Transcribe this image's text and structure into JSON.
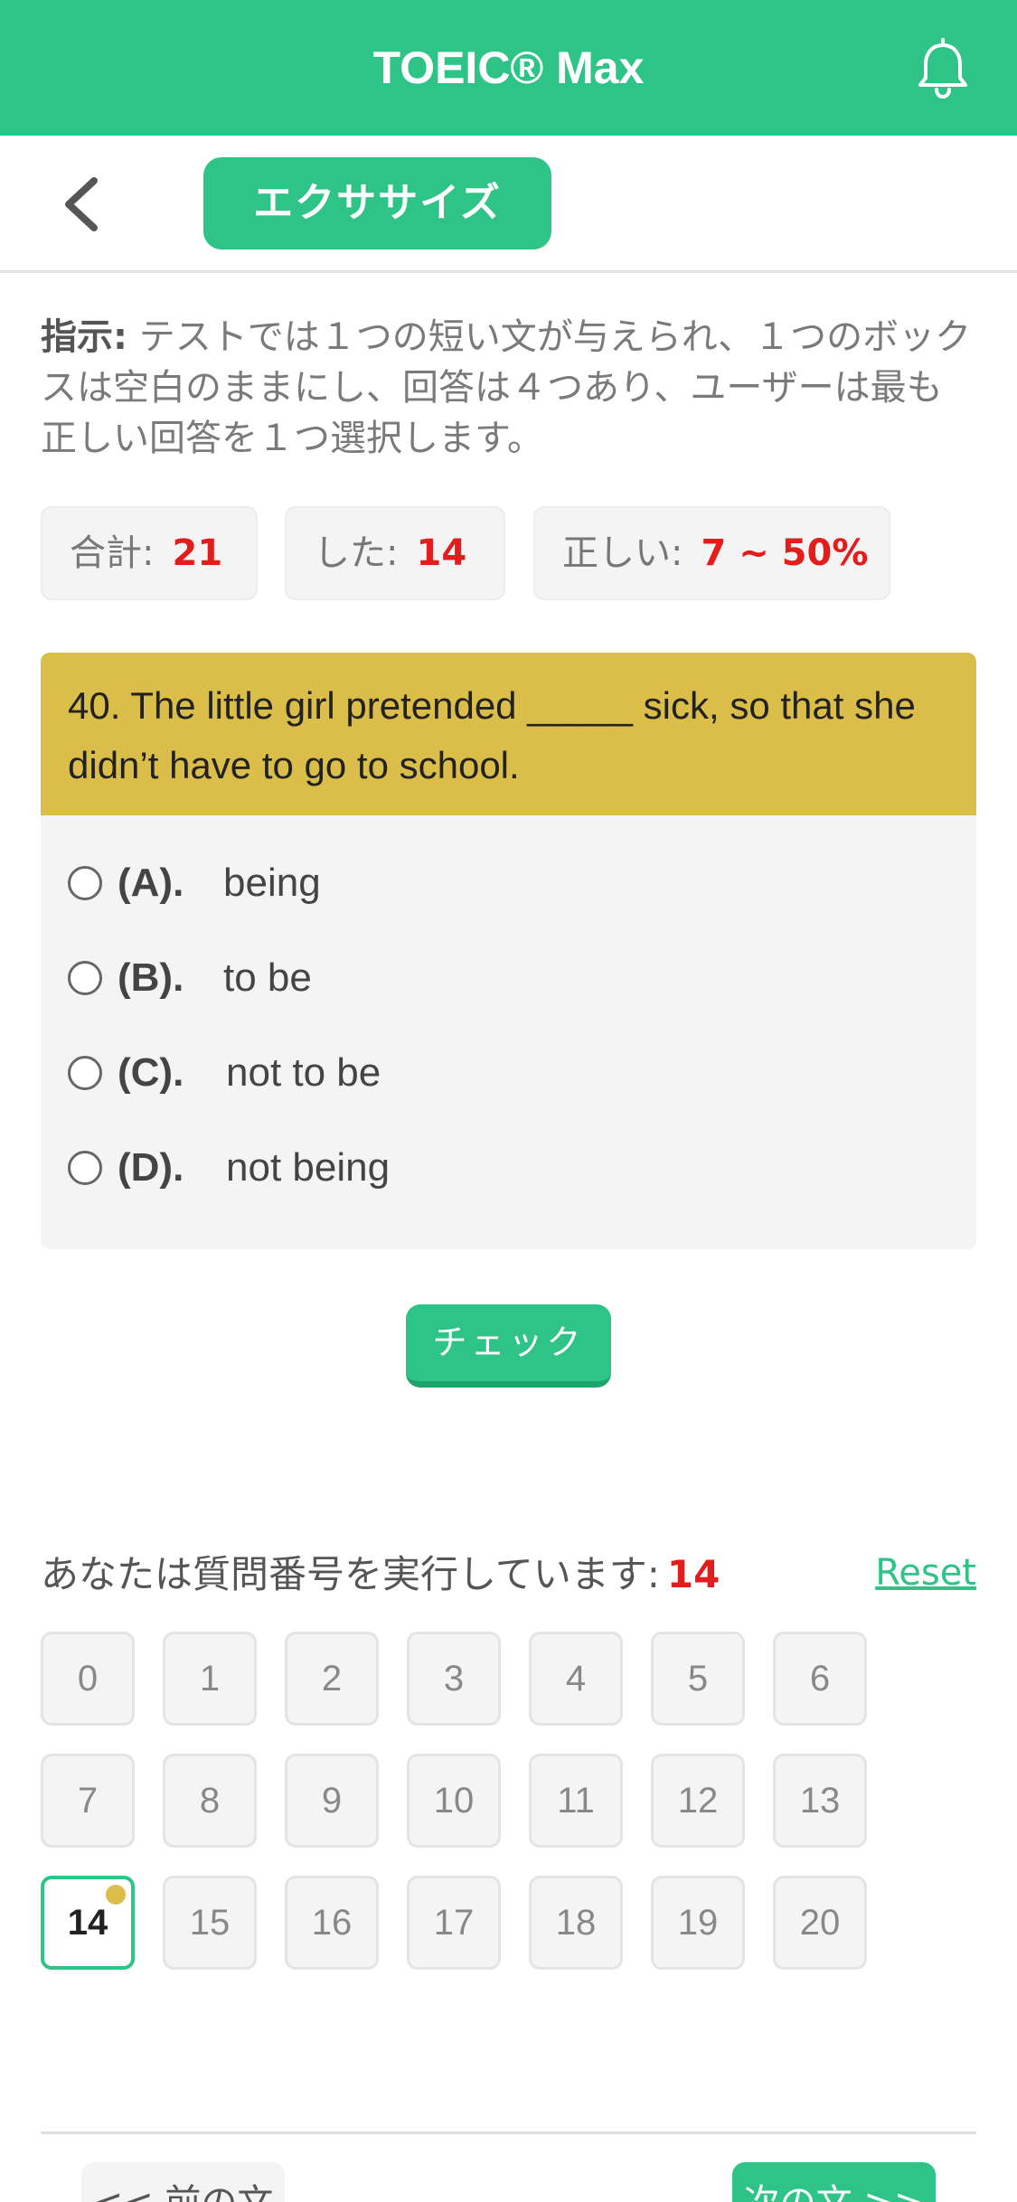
{
  "appbar": {
    "title": "TOEIC® Max",
    "bell_icon": "bell-icon"
  },
  "subheader": {
    "back_icon": "chevron-left-icon",
    "tab_label": "エクササイズ"
  },
  "instruction": {
    "label": "指示:",
    "text": "テストでは１つの短い文が与えられ、１つのボックスは空白のままにし、回答は４つあり、ユーザーは最も正しい回答を１つ選択します。"
  },
  "stats": {
    "total_label": "合計:",
    "total_value": "21",
    "done_label": "した:",
    "done_value": "14",
    "correct_label": "正しい:",
    "correct_value": "7 ~ 50%"
  },
  "question": {
    "text": "40. The little girl pretended _____ sick, so that she didn’t have to go to school.",
    "options": [
      {
        "key": "(A).",
        "text": "being"
      },
      {
        "key": "(B).",
        "text": "to be"
      },
      {
        "key": "(C).",
        "text": "not to be"
      },
      {
        "key": "(D).",
        "text": "not being"
      }
    ]
  },
  "check_button": "チェック",
  "progress": {
    "label": "あなたは質問番号を実行しています:",
    "current": "14",
    "reset": "Reset",
    "numbers": [
      "0",
      "1",
      "2",
      "3",
      "4",
      "5",
      "6",
      "7",
      "8",
      "9",
      "10",
      "11",
      "12",
      "13",
      "14",
      "15",
      "16",
      "17",
      "18",
      "19",
      "20"
    ]
  },
  "nav": {
    "prev": "<< 前の文",
    "next": "次の文 >>"
  },
  "colors": {
    "primary": "#2ec487",
    "question_header": "#dbbe4a",
    "accent_red": "#e31c1c"
  }
}
